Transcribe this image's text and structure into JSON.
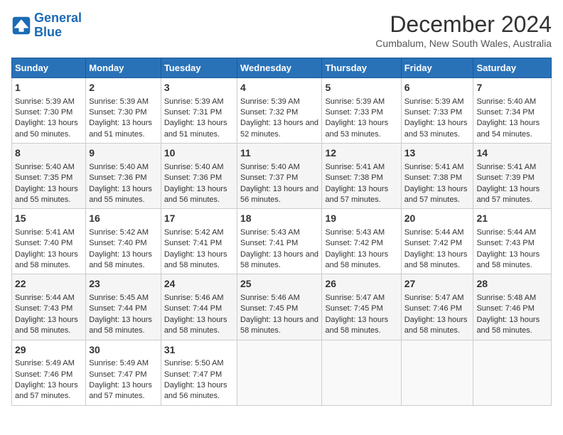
{
  "header": {
    "logo_line1": "General",
    "logo_line2": "Blue",
    "title": "December 2024",
    "subtitle": "Cumbalum, New South Wales, Australia"
  },
  "weekdays": [
    "Sunday",
    "Monday",
    "Tuesday",
    "Wednesday",
    "Thursday",
    "Friday",
    "Saturday"
  ],
  "weeks": [
    [
      {
        "day": "1",
        "sunrise": "5:39 AM",
        "sunset": "7:30 PM",
        "daylight": "13 hours and 50 minutes."
      },
      {
        "day": "2",
        "sunrise": "5:39 AM",
        "sunset": "7:30 PM",
        "daylight": "13 hours and 51 minutes."
      },
      {
        "day": "3",
        "sunrise": "5:39 AM",
        "sunset": "7:31 PM",
        "daylight": "13 hours and 51 minutes."
      },
      {
        "day": "4",
        "sunrise": "5:39 AM",
        "sunset": "7:32 PM",
        "daylight": "13 hours and 52 minutes."
      },
      {
        "day": "5",
        "sunrise": "5:39 AM",
        "sunset": "7:33 PM",
        "daylight": "13 hours and 53 minutes."
      },
      {
        "day": "6",
        "sunrise": "5:39 AM",
        "sunset": "7:33 PM",
        "daylight": "13 hours and 53 minutes."
      },
      {
        "day": "7",
        "sunrise": "5:40 AM",
        "sunset": "7:34 PM",
        "daylight": "13 hours and 54 minutes."
      }
    ],
    [
      {
        "day": "8",
        "sunrise": "5:40 AM",
        "sunset": "7:35 PM",
        "daylight": "13 hours and 55 minutes."
      },
      {
        "day": "9",
        "sunrise": "5:40 AM",
        "sunset": "7:36 PM",
        "daylight": "13 hours and 55 minutes."
      },
      {
        "day": "10",
        "sunrise": "5:40 AM",
        "sunset": "7:36 PM",
        "daylight": "13 hours and 56 minutes."
      },
      {
        "day": "11",
        "sunrise": "5:40 AM",
        "sunset": "7:37 PM",
        "daylight": "13 hours and 56 minutes."
      },
      {
        "day": "12",
        "sunrise": "5:41 AM",
        "sunset": "7:38 PM",
        "daylight": "13 hours and 57 minutes."
      },
      {
        "day": "13",
        "sunrise": "5:41 AM",
        "sunset": "7:38 PM",
        "daylight": "13 hours and 57 minutes."
      },
      {
        "day": "14",
        "sunrise": "5:41 AM",
        "sunset": "7:39 PM",
        "daylight": "13 hours and 57 minutes."
      }
    ],
    [
      {
        "day": "15",
        "sunrise": "5:41 AM",
        "sunset": "7:40 PM",
        "daylight": "13 hours and 58 minutes."
      },
      {
        "day": "16",
        "sunrise": "5:42 AM",
        "sunset": "7:40 PM",
        "daylight": "13 hours and 58 minutes."
      },
      {
        "day": "17",
        "sunrise": "5:42 AM",
        "sunset": "7:41 PM",
        "daylight": "13 hours and 58 minutes."
      },
      {
        "day": "18",
        "sunrise": "5:43 AM",
        "sunset": "7:41 PM",
        "daylight": "13 hours and 58 minutes."
      },
      {
        "day": "19",
        "sunrise": "5:43 AM",
        "sunset": "7:42 PM",
        "daylight": "13 hours and 58 minutes."
      },
      {
        "day": "20",
        "sunrise": "5:44 AM",
        "sunset": "7:42 PM",
        "daylight": "13 hours and 58 minutes."
      },
      {
        "day": "21",
        "sunrise": "5:44 AM",
        "sunset": "7:43 PM",
        "daylight": "13 hours and 58 minutes."
      }
    ],
    [
      {
        "day": "22",
        "sunrise": "5:44 AM",
        "sunset": "7:43 PM",
        "daylight": "13 hours and 58 minutes."
      },
      {
        "day": "23",
        "sunrise": "5:45 AM",
        "sunset": "7:44 PM",
        "daylight": "13 hours and 58 minutes."
      },
      {
        "day": "24",
        "sunrise": "5:46 AM",
        "sunset": "7:44 PM",
        "daylight": "13 hours and 58 minutes."
      },
      {
        "day": "25",
        "sunrise": "5:46 AM",
        "sunset": "7:45 PM",
        "daylight": "13 hours and 58 minutes."
      },
      {
        "day": "26",
        "sunrise": "5:47 AM",
        "sunset": "7:45 PM",
        "daylight": "13 hours and 58 minutes."
      },
      {
        "day": "27",
        "sunrise": "5:47 AM",
        "sunset": "7:46 PM",
        "daylight": "13 hours and 58 minutes."
      },
      {
        "day": "28",
        "sunrise": "5:48 AM",
        "sunset": "7:46 PM",
        "daylight": "13 hours and 58 minutes."
      }
    ],
    [
      {
        "day": "29",
        "sunrise": "5:49 AM",
        "sunset": "7:46 PM",
        "daylight": "13 hours and 57 minutes."
      },
      {
        "day": "30",
        "sunrise": "5:49 AM",
        "sunset": "7:47 PM",
        "daylight": "13 hours and 57 minutes."
      },
      {
        "day": "31",
        "sunrise": "5:50 AM",
        "sunset": "7:47 PM",
        "daylight": "13 hours and 56 minutes."
      },
      null,
      null,
      null,
      null
    ]
  ]
}
